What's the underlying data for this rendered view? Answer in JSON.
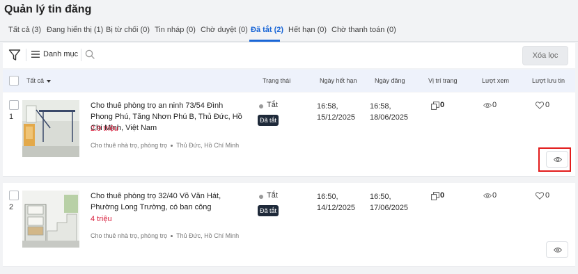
{
  "page": {
    "title": "Quản lý tin đăng"
  },
  "tabs": [
    {
      "label": "Tất cả (3)"
    },
    {
      "label": "Đang hiển thị (1)"
    },
    {
      "label": "Bị từ chối (0)"
    },
    {
      "label": "Tin nháp (0)"
    },
    {
      "label": "Chờ duyệt (0)"
    },
    {
      "label": "Đã tắt (2)"
    },
    {
      "label": "Hết hạn (0)"
    },
    {
      "label": "Chờ thanh toán (0)"
    }
  ],
  "active_tab": "Đã tắt (2)",
  "toolbar": {
    "category_label": "Danh mục",
    "clear_filter_label": "Xóa lọc"
  },
  "table_header": {
    "all_label": "Tất cả",
    "status": "Trạng thái",
    "expiry": "Ngày hết hạn",
    "posted": "Ngày đăng",
    "position": "Vị trí trang",
    "views": "Lượt xem",
    "saves": "Lượt lưu tin"
  },
  "listings": [
    {
      "index": "1",
      "title": "Cho thuê phòng trọ an ninh 73/54 Đình Phong Phú, Tăng Nhơn Phú B, Thủ Đức, Hồ Chí Minh, Việt Nam",
      "price": "2.9 triệu",
      "category": "Cho thuê nhà trọ, phòng trọ",
      "location": "Thủ Đức, Hồ Chí Minh",
      "status_text": "Tắt",
      "status_badge": "Đã tắt",
      "expiry_time": "16:58,",
      "expiry_date": "15/12/2025",
      "posted_time": "16:58,",
      "posted_date": "18/06/2025",
      "position": "0",
      "views": "0",
      "saves": "0"
    },
    {
      "index": "2",
      "title": "Cho thuê phòng trọ 32/40 Võ Văn Hát, Phường Long Trường, có ban công",
      "price": "4 triệu",
      "category": "Cho thuê nhà trọ, phòng trọ",
      "location": "Thủ Đức, Hồ Chí Minh",
      "status_text": "Tắt",
      "status_badge": "Đã tắt",
      "expiry_time": "16:50,",
      "expiry_date": "14/12/2025",
      "posted_time": "16:50,",
      "posted_date": "17/06/2025",
      "position": "0",
      "views": "0",
      "saves": "0"
    }
  ],
  "colors": {
    "accent": "#1a66d6",
    "price": "#d81b3a",
    "badge": "#1f2a3a",
    "highlight": "#e21b1b"
  }
}
